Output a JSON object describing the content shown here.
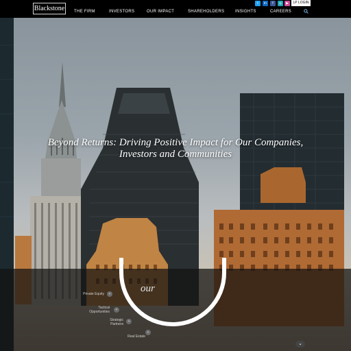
{
  "header": {
    "logo_text": "Blackstone",
    "nav": [
      {
        "label": "THE FIRM"
      },
      {
        "label": "INVESTORS"
      },
      {
        "label": "OUR IMPACT"
      },
      {
        "label": "SHAREHOLDERS"
      },
      {
        "label": "INSIGHTS"
      },
      {
        "label": "CAREERS"
      }
    ],
    "search_icon": "search-icon",
    "social": [
      {
        "icon": "twitter-icon",
        "glyph": "t",
        "color": "#1da1f2"
      },
      {
        "icon": "linkedin-icon",
        "glyph": "in",
        "color": "#0a66c2"
      },
      {
        "icon": "facebook-icon",
        "glyph": "f",
        "color": "#3b5998"
      },
      {
        "icon": "instagram-icon",
        "glyph": "◎",
        "color": "#1aa3b5"
      },
      {
        "icon": "youtube-icon",
        "glyph": "▶",
        "color": "#d04a9b"
      }
    ],
    "login_label": "LP LOGIN"
  },
  "hero": {
    "headline_line1": "Beyond Returns: Driving Positive Impact for Our Companies,",
    "headline_line2": "Investors and Communities"
  },
  "impact": {
    "arc_word": "our",
    "segments": [
      {
        "label": "Private Equity",
        "glyph": "+"
      },
      {
        "label": "Tactical Opportunities",
        "glyph": "+"
      },
      {
        "label": "Strategic Partners",
        "glyph": "+"
      },
      {
        "label": "Real Estate",
        "glyph": "+"
      }
    ],
    "scroll_glyph": "⌄"
  }
}
